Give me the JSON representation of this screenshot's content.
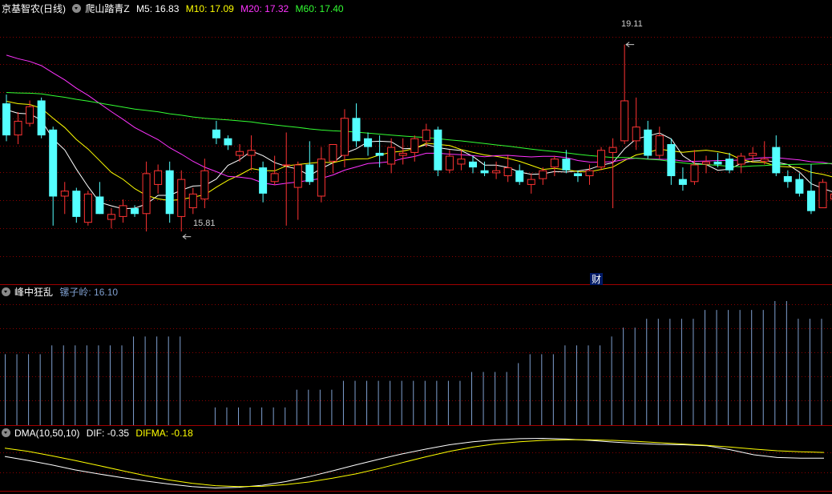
{
  "header": {
    "stock": "京基智农(日线)",
    "indicator": "爬山踏青Z",
    "m5": "M5: 16.83",
    "m10": "M10: 17.09",
    "m20": "M20: 17.32",
    "m60": "M60: 17.40"
  },
  "panel2": {
    "title": "峰中狂乱",
    "value": "镙子岭: 16.10"
  },
  "panel3": {
    "title": "DMA(10,50,10)",
    "dif": "DIF: -0.35",
    "difma": "DIFMA: -0.18"
  },
  "annotations": {
    "high": "19.11",
    "low": "15.81",
    "fin_marker": "财"
  },
  "colors": {
    "up": "#ff3333",
    "down": "#54ffff",
    "m5": "#ffffff",
    "m10": "#ffff00",
    "m20": "#ff33ff",
    "m60": "#33ff33",
    "grid": "#8b0000",
    "bars": "#7f9fcf",
    "label": "#7f9fcf"
  },
  "chart_data": [
    {
      "type": "candlestick",
      "title": "京基智农(日线)",
      "ylim": [
        15.2,
        19.6
      ],
      "series": [
        {
          "name": "K",
          "ohlc": [
            [
              18.1,
              18.25,
              17.45,
              17.55
            ],
            [
              17.55,
              17.95,
              17.4,
              17.8
            ],
            [
              17.75,
              18.15,
              17.7,
              18.05
            ],
            [
              18.15,
              18.2,
              17.5,
              17.55
            ],
            [
              17.65,
              17.7,
              16.0,
              16.5
            ],
            [
              16.5,
              16.75,
              16.2,
              16.6
            ],
            [
              16.6,
              16.65,
              16.05,
              16.15
            ],
            [
              16.05,
              16.6,
              16.0,
              16.55
            ],
            [
              16.5,
              16.75,
              16.2,
              16.2
            ],
            [
              16.1,
              16.3,
              15.95,
              16.2
            ],
            [
              16.15,
              16.45,
              16.05,
              16.35
            ],
            [
              16.3,
              16.35,
              16.15,
              16.2
            ],
            [
              16.2,
              17.1,
              15.9,
              16.9
            ],
            [
              16.7,
              17.05,
              16.55,
              16.95
            ],
            [
              16.95,
              17.1,
              16.05,
              16.2
            ],
            [
              16.15,
              16.95,
              15.9,
              16.8
            ],
            [
              16.3,
              16.65,
              16.2,
              16.55
            ],
            [
              16.45,
              17.15,
              16.3,
              16.95
            ],
            [
              17.65,
              17.8,
              17.4,
              17.5
            ],
            [
              17.5,
              17.55,
              17.3,
              17.38
            ],
            [
              17.2,
              17.4,
              17.1,
              17.28
            ],
            [
              17.2,
              17.55,
              16.95,
              17.3
            ],
            [
              17.0,
              17.1,
              16.4,
              16.55
            ],
            [
              16.75,
              17.2,
              16.7,
              16.9
            ],
            [
              17.05,
              17.6,
              16.0,
              17.05
            ],
            [
              16.65,
              17.1,
              16.1,
              17.05
            ],
            [
              17.05,
              17.45,
              16.7,
              16.75
            ],
            [
              16.5,
              17.35,
              16.4,
              17.15
            ],
            [
              17.1,
              17.4,
              16.9,
              17.4
            ],
            [
              17.2,
              18.0,
              17.0,
              17.85
            ],
            [
              17.85,
              18.1,
              17.35,
              17.45
            ],
            [
              17.5,
              17.6,
              17.2,
              17.35
            ],
            [
              17.25,
              17.55,
              17.0,
              17.2
            ],
            [
              17.05,
              17.5,
              16.9,
              17.35
            ],
            [
              17.2,
              17.5,
              17.05,
              17.25
            ],
            [
              17.25,
              17.55,
              17.1,
              17.5
            ],
            [
              17.45,
              17.75,
              17.35,
              17.65
            ],
            [
              17.65,
              17.7,
              16.85,
              16.95
            ],
            [
              16.95,
              17.3,
              16.9,
              17.2
            ],
            [
              17.05,
              17.3,
              16.95,
              17.15
            ],
            [
              17.1,
              17.2,
              16.9,
              17.0
            ],
            [
              16.95,
              17.1,
              16.85,
              16.9
            ],
            [
              16.9,
              17.1,
              16.8,
              16.95
            ],
            [
              16.85,
              17.2,
              16.75,
              17.0
            ],
            [
              16.95,
              17.05,
              16.7,
              16.75
            ],
            [
              16.7,
              16.9,
              16.55,
              16.8
            ],
            [
              16.8,
              17.0,
              16.7,
              16.95
            ],
            [
              17.0,
              17.2,
              16.85,
              17.15
            ],
            [
              17.15,
              17.3,
              16.9,
              16.95
            ],
            [
              16.9,
              16.95,
              16.75,
              16.85
            ],
            [
              16.85,
              17.05,
              16.7,
              16.95
            ],
            [
              17.0,
              17.35,
              16.95,
              17.3
            ],
            [
              17.25,
              17.5,
              16.3,
              17.35
            ],
            [
              17.45,
              19.11,
              17.4,
              18.15
            ],
            [
              17.45,
              18.2,
              17.3,
              17.7
            ],
            [
              17.65,
              17.8,
              17.15,
              17.2
            ],
            [
              17.2,
              17.7,
              17.15,
              17.55
            ],
            [
              17.4,
              17.5,
              16.7,
              16.85
            ],
            [
              16.8,
              17.0,
              16.6,
              16.7
            ],
            [
              16.75,
              17.3,
              16.7,
              17.05
            ],
            [
              17.05,
              17.2,
              16.9,
              17.1
            ],
            [
              17.1,
              17.25,
              17.0,
              17.05
            ],
            [
              17.15,
              17.25,
              16.9,
              16.95
            ],
            [
              17.05,
              17.25,
              16.9,
              17.2
            ],
            [
              17.2,
              17.35,
              17.1,
              17.25
            ],
            [
              17.1,
              17.45,
              17.05,
              17.15
            ],
            [
              17.35,
              17.55,
              16.85,
              16.9
            ],
            [
              16.85,
              16.95,
              16.65,
              16.75
            ],
            [
              16.8,
              16.9,
              16.5,
              16.55
            ],
            [
              16.6,
              17.05,
              16.2,
              16.25
            ],
            [
              16.3,
              16.8,
              16.3,
              16.75
            ],
            [
              16.45,
              16.6,
              16.4,
              16.55
            ]
          ]
        },
        {
          "name": "M5",
          "value": "16.83"
        },
        {
          "name": "M10",
          "value": "17.09"
        },
        {
          "name": "M20",
          "value": "17.32"
        },
        {
          "name": "M60",
          "value": "17.40"
        }
      ],
      "annotations": [
        {
          "label": "19.11",
          "bar": 53
        },
        {
          "label": "15.81",
          "bar": 15
        }
      ]
    },
    {
      "type": "bar",
      "title": "峰中狂乱",
      "series": [
        {
          "name": "镙子岭",
          "last": "16.10"
        }
      ],
      "values": [
        8,
        8,
        8,
        8,
        9,
        9,
        9,
        9,
        9,
        9,
        9,
        10,
        10,
        10,
        10,
        10,
        0,
        0,
        2,
        2,
        2,
        2,
        2,
        2,
        2,
        4,
        4,
        4,
        4,
        5,
        5,
        5,
        5,
        5,
        5,
        5,
        5,
        5,
        5,
        5,
        6,
        6,
        6,
        6,
        7,
        8,
        8,
        8,
        9,
        9,
        9,
        9,
        10,
        11,
        11,
        12,
        12,
        12,
        12,
        12,
        13,
        13,
        13,
        13,
        13,
        13,
        14,
        14,
        12,
        12,
        12,
        12
      ]
    },
    {
      "type": "line",
      "title": "DMA(10,50,10)",
      "series": [
        {
          "name": "DIF",
          "last": "-0.35",
          "values": [
            -0.3,
            -0.42,
            -0.55,
            -0.7,
            -0.82,
            -0.93,
            -1.03,
            -1.12,
            -1.2,
            -1.24,
            -1.22,
            -1.16,
            -1.05,
            -0.9,
            -0.73,
            -0.55,
            -0.38,
            -0.22,
            -0.08,
            0.05,
            0.14,
            0.2,
            0.23,
            0.24,
            0.22,
            0.18,
            0.13,
            0.09,
            0.06,
            0.05,
            0.02,
            -0.1,
            -0.25,
            -0.33,
            -0.35,
            -0.35
          ]
        },
        {
          "name": "DIFMA",
          "last": "-0.18",
          "values": [
            -0.05,
            -0.15,
            -0.28,
            -0.42,
            -0.57,
            -0.72,
            -0.87,
            -1.0,
            -1.1,
            -1.17,
            -1.2,
            -1.19,
            -1.14,
            -1.06,
            -0.95,
            -0.82,
            -0.66,
            -0.48,
            -0.31,
            -0.15,
            -0.02,
            0.08,
            0.14,
            0.18,
            0.2,
            0.2,
            0.18,
            0.15,
            0.11,
            0.07,
            0.03,
            -0.02,
            -0.08,
            -0.13,
            -0.16,
            -0.18
          ]
        }
      ]
    }
  ]
}
